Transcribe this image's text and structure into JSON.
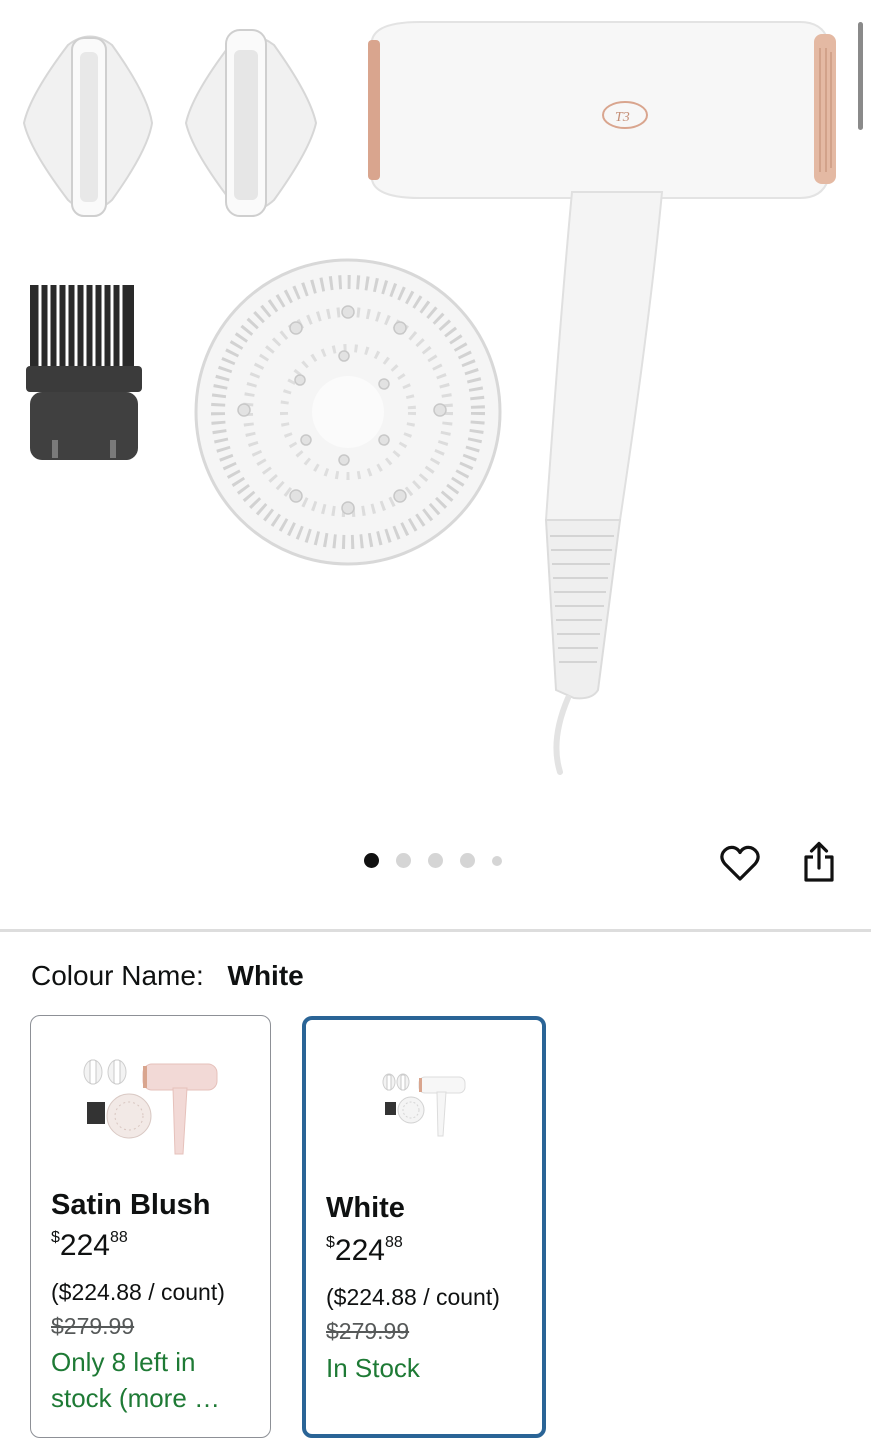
{
  "gallery": {
    "image_alt": "T3 hair dryer in White with attachments: two concentrator nozzles, wide-tooth comb and diffuser",
    "logo_text": "T3",
    "page_indicator": {
      "total": 5,
      "active": 1
    },
    "icons": {
      "favorite": "heart-icon",
      "share": "share-icon"
    }
  },
  "variation": {
    "label": "Colour Name:",
    "selected_value": "White",
    "options": [
      {
        "name": "Satin Blush",
        "price_currency": "$",
        "price_whole": "224",
        "price_fraction": "88",
        "unit_price": "($224.88 / count)",
        "list_price": "$279.99",
        "stock": "Only 8 left in stock (more …",
        "selected": false
      },
      {
        "name": "White",
        "price_currency": "$",
        "price_whole": "224",
        "price_fraction": "88",
        "unit_price": "($224.88 / count)",
        "list_price": "$279.99",
        "stock": "In Stock",
        "selected": true
      }
    ]
  },
  "colors": {
    "selected_border": "#2a6496",
    "stock_green": "#1e7a35",
    "text": "#0f1111",
    "muted": "#565959",
    "rose_gold": "#d9a58e",
    "blush": "#f2d9d6"
  }
}
